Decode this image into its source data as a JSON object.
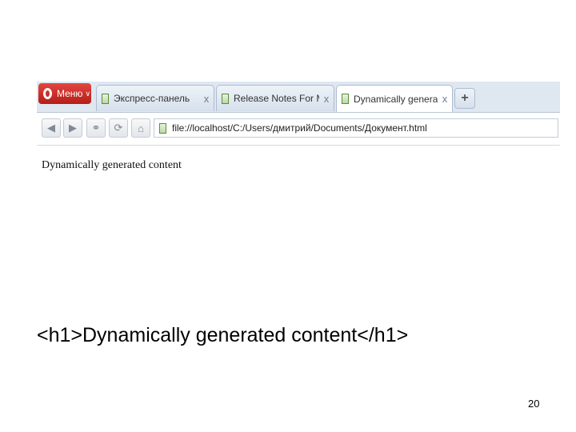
{
  "browser": {
    "menu_label": "Меню",
    "tabs": [
      {
        "label": "Экспресс-панель",
        "close": "x"
      },
      {
        "label": "Release Notes For Mat...",
        "close": "x"
      },
      {
        "label": "Dynamically generated...",
        "close": "x",
        "active": true
      }
    ],
    "add_tab": "+",
    "address": "file://localhost/C:/Users/дмитрий/Documents/Документ.html",
    "page_content": "Dynamically generated content"
  },
  "caption": "<h1>Dynamically generated content</h1>",
  "page_number": "20",
  "icons": [
    "opera-logo-icon",
    "page-icon",
    "back-icon",
    "forward-icon",
    "key-icon",
    "reload-icon",
    "home-icon"
  ],
  "colors": {
    "menu_red": "#c8281f",
    "tabbar_bg": "#dfe7f1"
  }
}
